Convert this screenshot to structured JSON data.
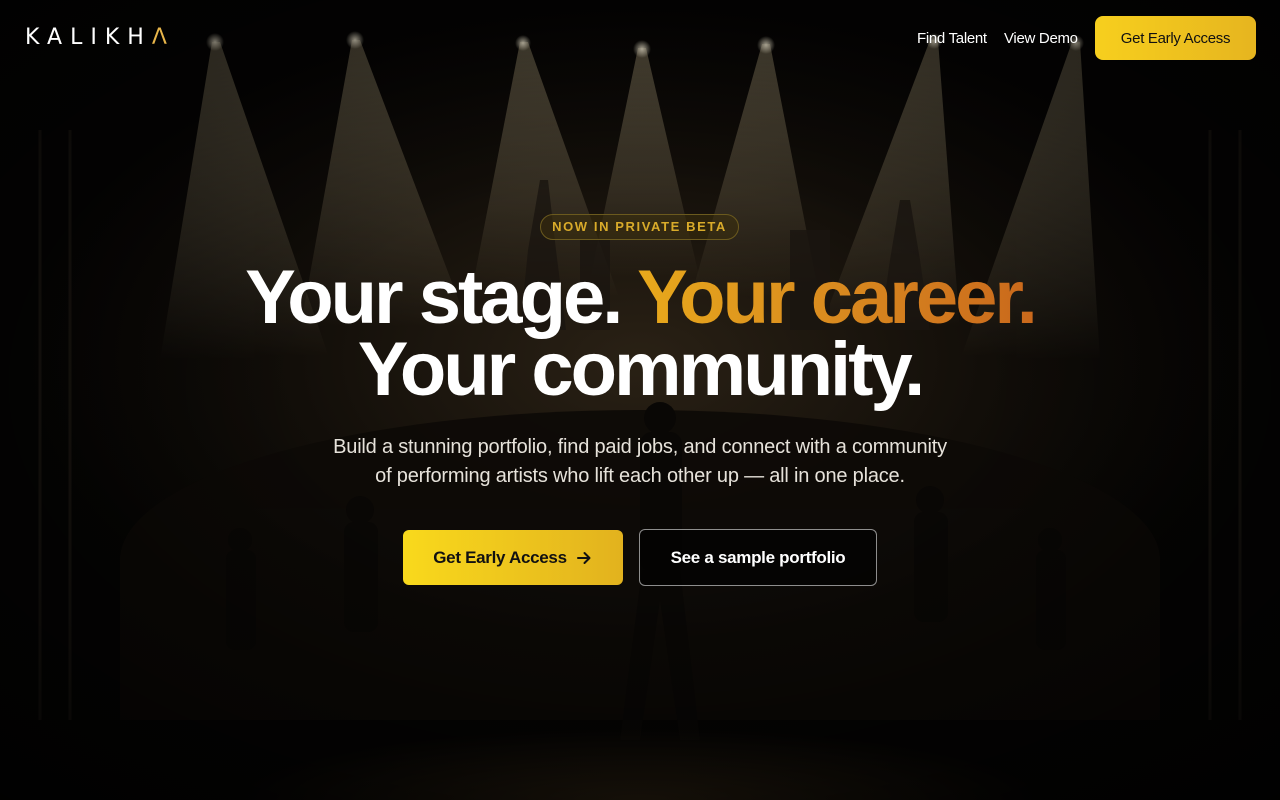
{
  "brand": {
    "logo_main": "KALIKH",
    "logo_accent": "Λ",
    "accent_color": "#e8b64a"
  },
  "nav": {
    "links": [
      "Find Talent",
      "View Demo"
    ],
    "cta_label": "Get Early Access"
  },
  "hero": {
    "badge": "NOW IN PRIVATE BETA",
    "headline_part1": "Your stage. ",
    "headline_part2": "Your career.",
    "headline_line2": "Your community.",
    "subtitle_line1": "Build a stunning portfolio, find paid jobs, and connect with a community",
    "subtitle_line2": "of performing artists who lift each other up — all in one place.",
    "primary_cta": "Get Early Access",
    "secondary_cta": "See a sample portfolio"
  },
  "icons": {
    "primary_cta_icon": "arrow-right-icon"
  },
  "colors": {
    "gold_start": "#f7cf1e",
    "gold_end": "#e2b21e",
    "headline_gold": "#d98a1f",
    "background": "#050403"
  }
}
